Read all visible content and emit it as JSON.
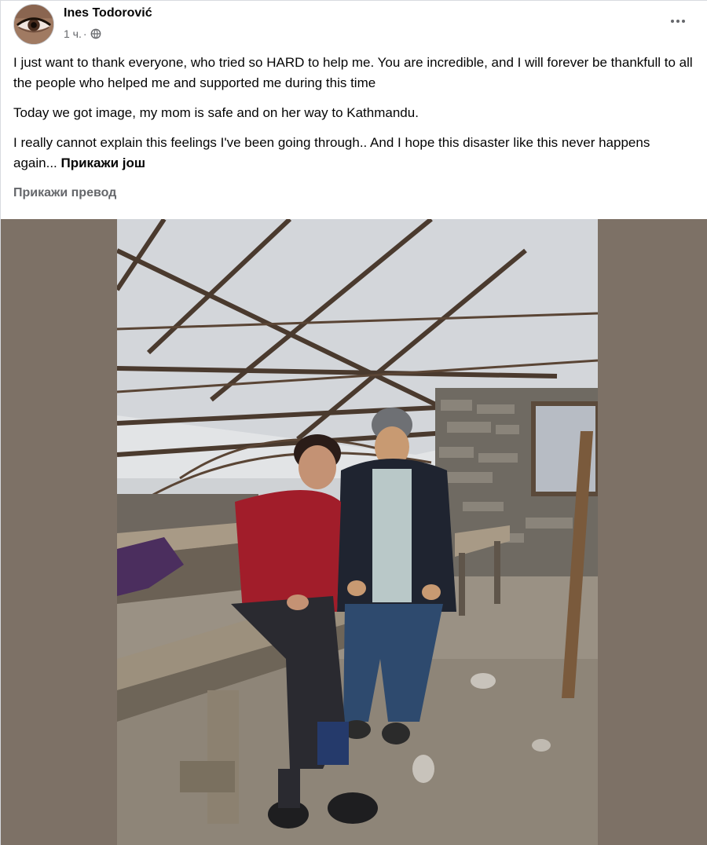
{
  "post": {
    "author": "Ines Todorović",
    "time": "1 ч.",
    "separator": "·",
    "privacy_icon": "globe-icon",
    "paragraphs": [
      "I just want to thank everyone, who tried so HARD to help me. You are incredible, and I will forever be thankfull to all the people who helped me and supported me during this time",
      "Today we got image, my mom is safe and on her way to Kathmandu.",
      "I really cannot explain this feelings I've been going through.. And I hope this disaster like this never happens again..."
    ],
    "see_more": "Прикажи још",
    "translate": "Прикажи превод",
    "more_icon": "more-options-icon"
  },
  "colors": {
    "text": "#050505",
    "secondary": "#65676b",
    "photo_background": "#7d7166"
  }
}
